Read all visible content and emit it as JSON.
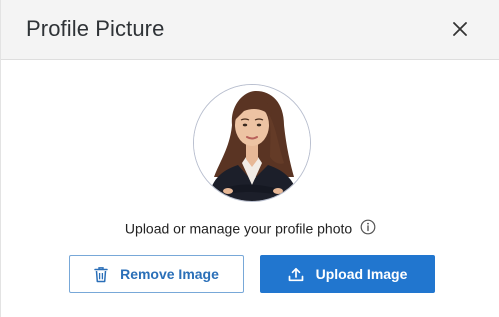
{
  "dialog": {
    "title": "Profile Picture",
    "close_icon": "close-icon"
  },
  "avatar": {
    "description_icon": "profile-photo"
  },
  "caption": {
    "text": "Upload or manage your profile photo",
    "icon": "info-icon"
  },
  "buttons": {
    "remove_label": "Remove Image",
    "remove_icon": "trash-icon",
    "upload_label": "Upload Image",
    "upload_icon": "upload-icon"
  },
  "colors": {
    "primary": "#2176cf",
    "outline": "#78a8d8",
    "header_bg": "#f4f4f4"
  }
}
